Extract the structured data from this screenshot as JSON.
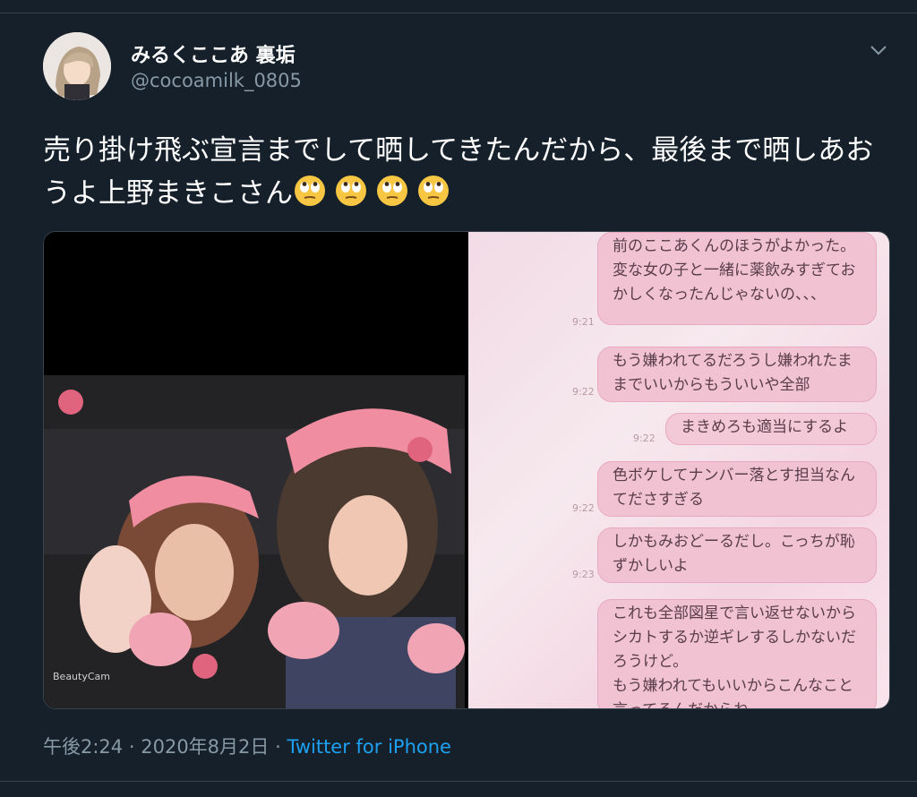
{
  "user": {
    "display_name": "みるくここあ 裏垢",
    "handle": "@cocoamilk_0805"
  },
  "tweet": {
    "text": "売り掛け飛ぶ宣言までして晒してきたんだから、最後まで晒しあおうよ上野まきこさん",
    "emoji": [
      "face-with-rolling-eyes-icon",
      "face-with-rolling-eyes-icon",
      "face-with-rolling-eyes-icon",
      "face-with-rolling-eyes-icon"
    ]
  },
  "media": {
    "left_photo_watermark": "BeautyCam",
    "chat": [
      {
        "text": "前のここあくんのほうがよかった。変な女の子と一緒に薬飲みすぎておかしくなったんじゃないの、、、",
        "time": "9:21",
        "side": "left"
      },
      {
        "text": "もう嫌われてるだろうし嫌われたままでいいからもういいや全部",
        "time": "9:22",
        "side": "left"
      },
      {
        "text": "まきめろも適当にするよ",
        "time": "9:22",
        "side": "right"
      },
      {
        "text": "色ボケしてナンバー落とす担当なんてださすぎる",
        "time": "9:22",
        "side": "left"
      },
      {
        "text": "しかもみおどーるだし。こっちが恥ずかしいよ",
        "time": "9:23",
        "side": "left"
      },
      {
        "text": "これも全部図星で言い返せないからシカトするか逆ギレするしかないだろうけど。\nもう嫌われてもいいからこんなこと言ってるんだからね",
        "time": "",
        "side": "left"
      }
    ]
  },
  "footer": {
    "time": "午後2:24",
    "date": "2020年8月2日",
    "separator": "·",
    "source": "Twitter for iPhone"
  },
  "colors": {
    "background": "#15202b",
    "accent": "#1da1f2",
    "muted": "#8899a6"
  }
}
